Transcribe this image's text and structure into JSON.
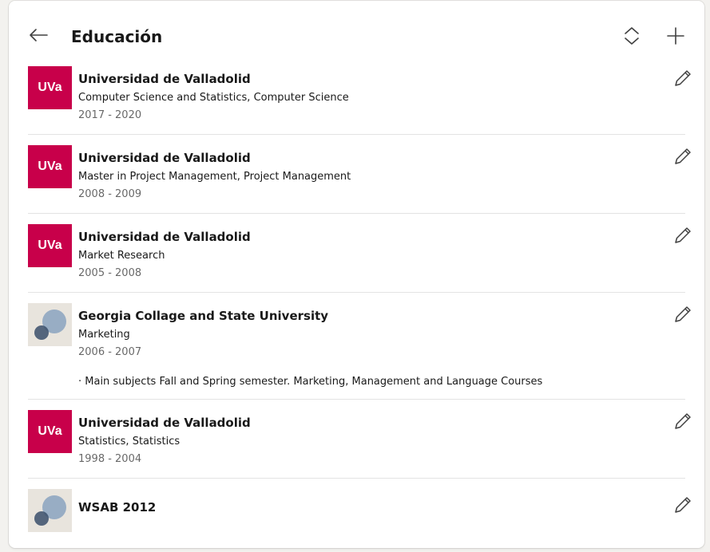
{
  "header": {
    "title": "Educación",
    "back_icon": "arrow-left-icon",
    "reorder_icon": "reorder-icon",
    "add_icon": "plus-icon"
  },
  "colors": {
    "uva_brand": "#c8004a",
    "generic_logo_bg": "#e8e4dd",
    "generic_logo_circle": "#8aa3c0"
  },
  "education": [
    {
      "logo_text": "UVa",
      "logo_type": "uva",
      "school": "Universidad de Valladolid",
      "degree": "Computer Science and Statistics, Computer Science",
      "dates": "2017 - 2020",
      "description": "",
      "edit_icon": "pencil-icon"
    },
    {
      "logo_text": "UVa",
      "logo_type": "uva",
      "school": "Universidad de Valladolid",
      "degree": "Master in Project Management, Project Management",
      "dates": "2008 - 2009",
      "description": "",
      "edit_icon": "pencil-icon"
    },
    {
      "logo_text": "UVa",
      "logo_type": "uva",
      "school": "Universidad de Valladolid",
      "degree": "Market Research",
      "dates": "2005 - 2008",
      "description": "",
      "edit_icon": "pencil-icon"
    },
    {
      "logo_text": "",
      "logo_type": "generic",
      "school": "Georgia Collage and State University",
      "degree": "Marketing",
      "dates": "2006 - 2007",
      "description": "· Main subjects Fall and Spring semester. Marketing, Management and Language Courses",
      "edit_icon": "pencil-icon"
    },
    {
      "logo_text": "UVa",
      "logo_type": "uva",
      "school": "Universidad de Valladolid",
      "degree": "Statistics, Statistics",
      "dates": "1998 - 2004",
      "description": "",
      "edit_icon": "pencil-icon"
    },
    {
      "logo_text": "",
      "logo_type": "generic",
      "school": "WSAB 2012",
      "degree": "",
      "dates": "",
      "description": "",
      "edit_icon": "pencil-icon"
    }
  ]
}
